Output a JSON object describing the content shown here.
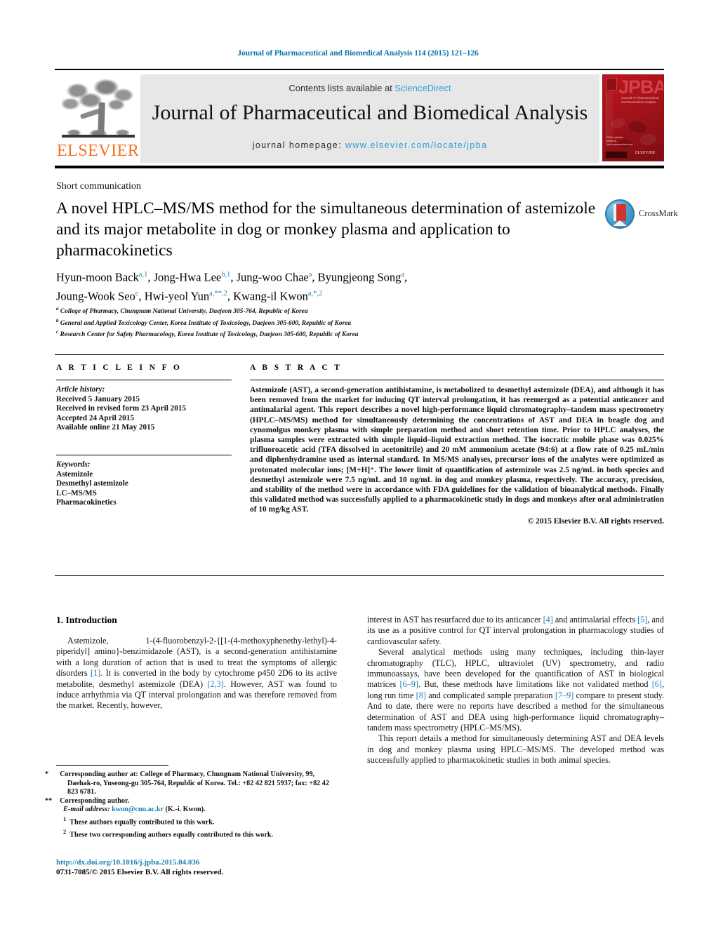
{
  "running_head": "Journal of Pharmaceutical and Biomedical Analysis 114 (2015) 121–126",
  "masthead": {
    "contents_prefix": "Contents lists available at ",
    "sciencedirect": "ScienceDirect",
    "journal_title": "Journal of Pharmaceutical and Biomedical Analysis",
    "homepage_prefix": "journal homepage: ",
    "homepage_url": "www.elsevier.com/locate/jpba",
    "publisher_wordmark": "ELSEVIER",
    "cover": {
      "acronym": "JPBA",
      "subtitle": "Journal of Pharmaceutical and Biomedical Analysis",
      "footer_note": "ISSN Available online at www.sciencedirect.com",
      "publisher": "ELSEVIER"
    },
    "colors": {
      "link_blue": "#2a9fd6",
      "elsevier_orange": "#F37021",
      "cover_red": "#a3121a",
      "header_blue": "#0b76a8"
    }
  },
  "article": {
    "section_type": "Short communication",
    "title": "A novel HPLC–MS/MS method for the simultaneous determination of astemizole and its major metabolite in dog or monkey plasma and application to pharmacokinetics",
    "crossmark_label": "CrossMark",
    "authors_line1_html": "Hyun-moon Back<sup>a,1</sup>, Jong-Hwa Lee<sup>b,1</sup>, Jung-woo Chae<sup>a</sup>, Byungjeong Song<sup>a</sup>,",
    "authors_line2_html": "Joung-Wook Seo<sup>c</sup>, Hwi-yeol Yun<sup>a,**,2</sup>, Kwang-il Kwon<sup>a,*,2</sup>",
    "affiliations": [
      "College of Pharmacy, Chungnam National University, Daejeon 305-764, Republic of Korea",
      "General and Applied Toxicology Center, Korea Institute of Toxicology, Daejeon 305-600, Republic of Korea",
      "Research Center for Safety Pharmacology, Korea Institute of Toxicology, Daejeon 305-600, Republic of Korea"
    ],
    "affiliation_marks": [
      "a",
      "b",
      "c"
    ]
  },
  "article_info": {
    "heading": "A R T I C L E   I N F O",
    "history_label": "Article history:",
    "history": [
      "Received 5 January 2015",
      "Received in revised form 23 April 2015",
      "Accepted 24 April 2015",
      "Available online 21 May 2015"
    ],
    "keywords_label": "Keywords:",
    "keywords": [
      "Astemizole",
      "Desmethyl astemizole",
      "LC–MS/MS",
      "Pharmacokinetics"
    ]
  },
  "abstract": {
    "heading": "A B S T R A C T",
    "text": "Astemizole (AST), a second-generation antihistamine, is metabolized to desmethyl astemizole (DEA), and although it has been removed from the market for inducing QT interval prolongation, it has reemerged as a potential anticancer and antimalarial agent. This report describes a novel high-performance liquid chromatography–tandem mass spectrometry (HPLC–MS/MS) method for simultaneously determining the concentrations of AST and DEA in beagle dog and cynomolgus monkey plasma with simple preparation method and short retention time. Prior to HPLC analyses, the plasma samples were extracted with simple liquid–liquid extraction method. The isocratic mobile phase was 0.025% trifluoroacetic acid (TFA dissolved in acetonitrile) and 20 mM ammonium acetate (94:6) at a flow rate of 0.25 mL/min and diphenhydramine used as internal standard. In MS/MS analyses, precursor ions of the analytes were optimized as protonated molecular ions; [M+H]⁺. The lower limit of quantification of astemizole was 2.5 ng/mL in both species and desmethyl astemizole were 7.5 ng/mL and 10 ng/mL in dog and monkey plasma, respectively. The accuracy, precision, and stability of the method were in accordance with FDA guidelines for the validation of bioanalytical methods. Finally this validated method was successfully applied to a pharmacokinetic study in dogs and monkeys after oral administration of 10 mg/kg AST.",
    "copyright": "© 2015 Elsevier B.V. All rights reserved."
  },
  "body": {
    "intro_heading": "1.  Introduction",
    "left_paragraph_1_html": "Astemizole, &nbsp;&nbsp;&nbsp; 1-(4-fluorobenzyl-2-{[1-(4-methoxyphenethy-lethyl)-4-piperidyl] amino}-benzimidazole (AST), is a second-generation antihistamine with a long duration of action that is used to treat the symptoms of allergic disorders <span class=\"ref\">[1]</span>. It is converted in the body by cytochrome p450 2D6 to its active metabolite, desmethyl astemizole (DEA) <span class=\"ref\">[2,3]</span>. However, AST was found to induce arrhythmia via QT interval prolongation and was therefore removed from the market. Recently, however,",
    "right_paragraph_1_html": "interest in AST has resurfaced due to its anticancer <span class=\"ref\">[4]</span> and antimalarial effects <span class=\"ref\">[5]</span>, and its use as a positive control for QT interval prolongation in pharmacology studies of cardiovascular safety.",
    "right_paragraph_2_html": "Several analytical methods using many techniques, including thin-layer chromatography (TLC), HPLC, ultraviolet (UV) spectrometry, and radio immunoassays, have been developed for the quantification of AST in biological matrices <span class=\"ref\">[6–9]</span>. But, these methods have limitations like not validated method <span class=\"ref\">[6]</span>, long run time <span class=\"ref\">[8]</span> and complicated sample preparation <span class=\"ref\">[7–9]</span> compare to present study. And to date, there were no reports have described a method for the simultaneous determination of AST and DEA using high-performance liquid chromatography–tandem mass spectrometry (HPLC–MS/MS).",
    "right_paragraph_3_html": "This report details a method for simultaneously determining AST and DEA levels in dog and monkey plasma using HPLC–MS/MS. The developed method was successfully applied to pharmacokinetic studies in both animal species."
  },
  "footnotes": {
    "corresponding_1_html": "<span class=\"mark\">*</span>&nbsp; Corresponding author at: College of Pharmacy, Chungnam National University, 99, Daehak-ro, Yuseong-gu 305-764, Republic of Korea. Tel.: +82 42 821 5937; fax: +82 42 823 6781.",
    "corresponding_2_html": "<span class=\"mark\">**</span>&nbsp; Corresponding author.",
    "email_html": "<span class=\"em\">E-mail address:</span> <span class=\"link\">kwon@cnu.ac.kr</span> (K.-i. Kwon).",
    "note_1_html": "<sup>1</sup>&nbsp; These authors equally contributed to this work.",
    "note_2_html": "<sup>2</sup>&nbsp; These two corresponding authors equally contributed to this work.",
    "doi_url": "http://dx.doi.org/10.1016/j.jpba.2015.04.036",
    "issn_line": "0731-7085/© 2015 Elsevier B.V. All rights reserved."
  }
}
